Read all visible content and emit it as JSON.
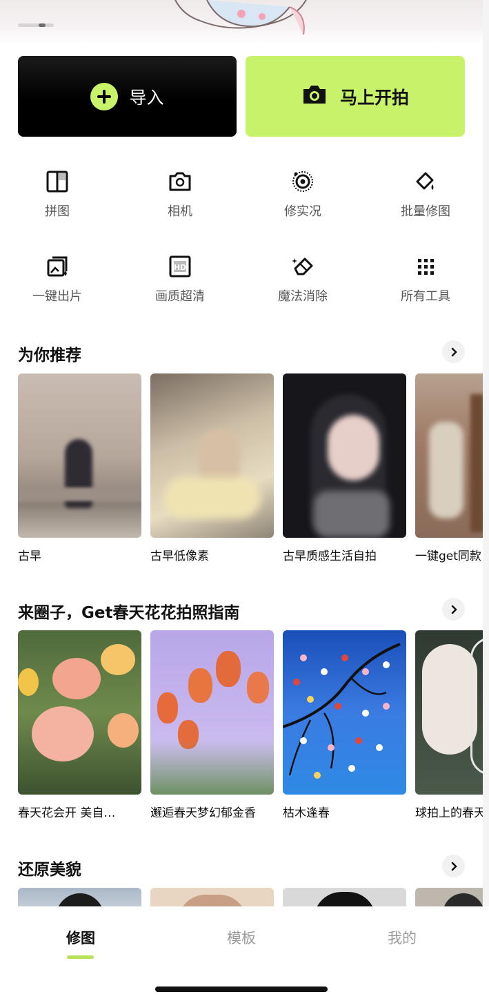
{
  "buttons": {
    "import_label": "导入",
    "shoot_label": "马上开拍"
  },
  "tools": [
    {
      "label": "拼图",
      "icon": "collage-icon"
    },
    {
      "label": "相机",
      "icon": "camera-icon"
    },
    {
      "label": "修实况",
      "icon": "live-photo-icon"
    },
    {
      "label": "批量修图",
      "icon": "batch-edit-icon"
    },
    {
      "label": "一键出片",
      "icon": "one-tap-photo-icon"
    },
    {
      "label": "画质超清",
      "icon": "hd-icon"
    },
    {
      "label": "魔法消除",
      "icon": "eraser-icon"
    },
    {
      "label": "所有工具",
      "icon": "grid-dots-icon"
    }
  ],
  "sections": [
    {
      "title": "为你推荐",
      "cards": [
        "古早",
        "古早低像素",
        "古早质感生活自拍",
        "一键get同款"
      ]
    },
    {
      "title": "来圈子，Get春天花花拍照指南",
      "cards": [
        "春天花会开 美自…",
        "邂逅春天梦幻郁金香",
        "枯木逢春",
        "球拍上的春天"
      ]
    },
    {
      "title": "还原美貌",
      "cards": []
    }
  ],
  "tabs": [
    {
      "label": "修图",
      "active": true
    },
    {
      "label": "模板",
      "active": false
    },
    {
      "label": "我的",
      "active": false
    }
  ],
  "colors": {
    "accent": "#c9f26b",
    "tab_indicator": "#b7e25a",
    "dark_button": "#000000"
  }
}
